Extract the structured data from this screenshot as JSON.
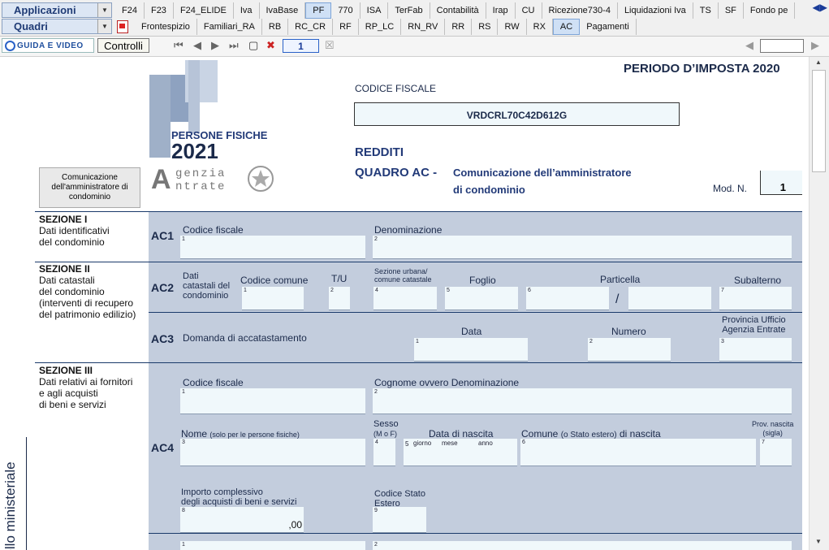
{
  "app": {
    "combo_applicazioni": "Applicazioni",
    "combo_quadri": "Quadri",
    "tabs_row1": [
      "F24",
      "F23",
      "F24_ELIDE",
      "Iva",
      "IvaBase",
      "PF",
      "770",
      "ISA",
      "TerFab",
      "Contabilità",
      "Irap",
      "CU",
      "Ricezione730-4",
      "Liquidazioni Iva",
      "TS",
      "SF",
      "Fondo pe"
    ],
    "tabs_row2": [
      "Frontespizio",
      "Familiari_RA",
      "RB",
      "RC_CR",
      "RF",
      "RP_LC",
      "RN_RV",
      "RR",
      "RS",
      "RW",
      "RX",
      "AC",
      "Pagamenti"
    ],
    "active_row1": "PF",
    "active_row2": "AC"
  },
  "toolbar": {
    "guida_label": "GUIDA E VIDEO",
    "controlli_label": "Controlli",
    "page_number": "1"
  },
  "header": {
    "periodo": "PERIODO D’IMPOSTA 2020",
    "codice_fiscale_label": "CODICE FISCALE",
    "codice_fiscale_value": "VRDCRL70C42D612G",
    "logo_pf_letters": "PF",
    "logo_persone_fisiche": "PERSONE FISICHE",
    "logo_year": "2021",
    "agenzia_line1": "genzia",
    "agenzia_line2": "ntrate",
    "redditi": "REDDITI",
    "quadro_code": "QUADRO AC -",
    "quadro_title_1": "Comunicazione dell’amministratore",
    "quadro_title_2": "di condominio",
    "mod_label": "Mod. N.",
    "mod_value": "1",
    "side_button": "Comunicazione dell'amministratore di condominio"
  },
  "sections": {
    "s1_title": "SEZIONE I",
    "s1_sub": [
      "Dati identificativi",
      "del condominio"
    ],
    "s2_title": "SEZIONE II",
    "s2_sub": [
      "Dati catastali",
      "del condominio",
      "(interventi di recupero",
      "del patrimonio edilizio)"
    ],
    "s3_title": "SEZIONE III",
    "s3_sub": [
      "Dati relativi ai fornitori",
      "e agli acquisti",
      "di beni e servizi"
    ],
    "vertical_text": "dello ministeriale"
  },
  "ac1": {
    "code": "AC1",
    "codice_fiscale": "Codice fiscale",
    "denominazione": "Denominazione"
  },
  "ac2": {
    "code": "AC2",
    "dati_catastali": [
      "Dati",
      "catastali del",
      "condominio"
    ],
    "codice_comune": "Codice comune",
    "tu": "T/U",
    "sezione": [
      "Sezione urbana/",
      "comune catastale"
    ],
    "foglio": "Foglio",
    "particella": "Particella",
    "slash": "/",
    "subalterno": "Subalterno"
  },
  "ac3": {
    "code": "AC3",
    "domanda": "Domanda di accatastamento",
    "data": "Data",
    "numero": "Numero",
    "provincia": [
      "Provincia Ufficio",
      "Agenzia Entrate"
    ]
  },
  "ac4": {
    "code": "AC4",
    "codice_fiscale": "Codice fiscale",
    "cognome": "Cognome ovvero Denominazione",
    "nome": "Nome",
    "nome_note": "(solo per le persone fisiche)",
    "sesso": [
      "Sesso",
      "(M o F)"
    ],
    "data_nascita": "Data di nascita",
    "giorno": "giorno",
    "mese": "mese",
    "anno": "anno",
    "comune": "Comune",
    "comune_note": "(o Stato estero)",
    "comune_tail": "di nascita",
    "prov": [
      "Prov. nascita",
      "(sigla)"
    ],
    "importo": [
      "Importo complessivo",
      "degli acquisti di beni e servizi"
    ],
    "importo_value": ",00",
    "codice_stato": [
      "Codice Stato",
      "Estero"
    ]
  },
  "colors": {
    "band": "#c3cddd",
    "field": "#f0f8fb",
    "navy": "#1b2a4a",
    "active_tab": "#cfe0f5"
  }
}
